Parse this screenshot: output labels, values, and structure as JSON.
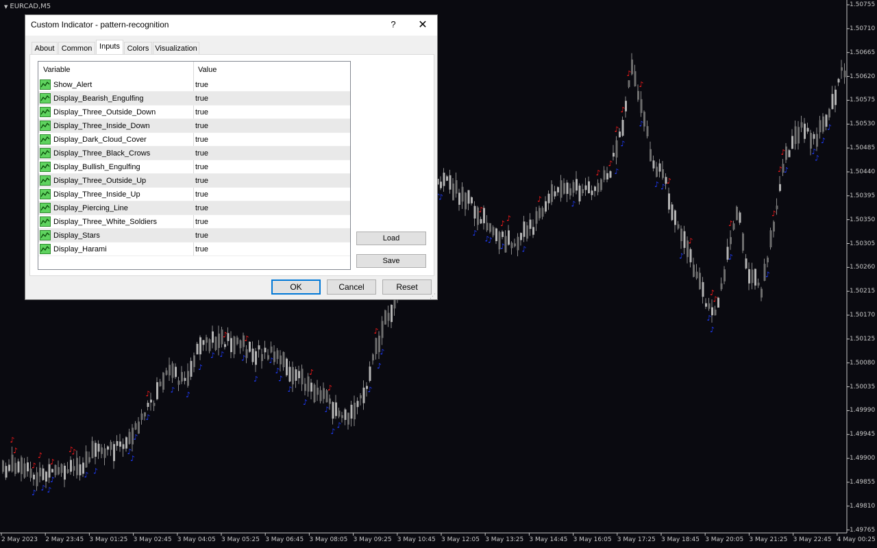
{
  "chart": {
    "symbol": "EURCAD,M5",
    "price_labels": [
      "1.50755",
      "1.50710",
      "1.50665",
      "1.50620",
      "1.50575",
      "1.50530",
      "1.50485",
      "1.50440",
      "1.50395",
      "1.50350",
      "1.50305",
      "1.50260",
      "1.50215",
      "1.50170",
      "1.50125",
      "1.50080",
      "1.50035",
      "1.49990",
      "1.49945",
      "1.49900",
      "1.49855",
      "1.49810",
      "1.49765"
    ],
    "time_labels": [
      "2 May 2023",
      "2 May 23:45",
      "3 May 01:25",
      "3 May 02:45",
      "3 May 04:05",
      "3 May 05:25",
      "3 May 06:45",
      "3 May 08:05",
      "3 May 09:25",
      "3 May 10:45",
      "3 May 12:05",
      "3 May 13:25",
      "3 May 14:45",
      "3 May 16:05",
      "3 May 17:25",
      "3 May 18:45",
      "3 May 20:05",
      "3 May 21:25",
      "3 May 22:45",
      "4 May 00:25"
    ],
    "colors": {
      "background": "#0a0a10",
      "candle": "#8c8c8c",
      "bearish_marker": "#ff1a1a",
      "bullish_marker": "#1f3cff"
    }
  },
  "dialog": {
    "title": "Custom Indicator - pattern-recognition",
    "help_glyph": "?",
    "close_glyph": "✕",
    "tabs": [
      {
        "label": "About",
        "active": false
      },
      {
        "label": "Common",
        "active": false
      },
      {
        "label": "Inputs",
        "active": true
      },
      {
        "label": "Colors",
        "active": false
      },
      {
        "label": "Visualization",
        "active": false
      }
    ],
    "grid": {
      "col_variable": "Variable",
      "col_value": "Value",
      "rows": [
        {
          "name": "Show_Alert",
          "value": "true"
        },
        {
          "name": "Display_Bearish_Engulfing",
          "value": "true"
        },
        {
          "name": "Display_Three_Outside_Down",
          "value": "true"
        },
        {
          "name": "Display_Three_Inside_Down",
          "value": "true"
        },
        {
          "name": "Display_Dark_Cloud_Cover",
          "value": "true"
        },
        {
          "name": "Display_Three_Black_Crows",
          "value": "true"
        },
        {
          "name": "Display_Bullish_Engulfing",
          "value": "true"
        },
        {
          "name": "Display_Three_Outside_Up",
          "value": "true"
        },
        {
          "name": "Display_Three_Inside_Up",
          "value": "true"
        },
        {
          "name": "Display_Piercing_Line",
          "value": "true"
        },
        {
          "name": "Display_Three_White_Soldiers",
          "value": "true"
        },
        {
          "name": "Display_Stars",
          "value": "true"
        },
        {
          "name": "Display_Harami",
          "value": "true"
        }
      ]
    },
    "buttons": {
      "load": "Load",
      "save": "Save",
      "ok": "OK",
      "cancel": "Cancel",
      "reset": "Reset"
    }
  }
}
